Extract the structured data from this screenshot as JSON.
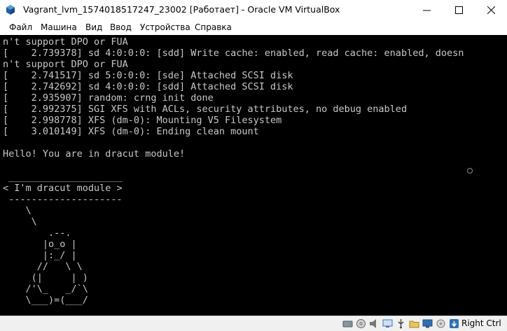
{
  "window": {
    "title": "Vagrant_lvm_1574018517247_23002 [Работает] - Oracle VM VirtualBox",
    "minimize_glyph": "—",
    "maximize_glyph": "☐",
    "close_glyph": "✕"
  },
  "menu": {
    "items": [
      {
        "label": "Файл"
      },
      {
        "label": "Машина"
      },
      {
        "label": "Вид"
      },
      {
        "label": "Ввод"
      },
      {
        "label": "Устройства"
      },
      {
        "label": "Справка"
      }
    ]
  },
  "console": {
    "lines": [
      "n't support DPO or FUA",
      "[    2.739378] sd 4:0:0:0: [sdd] Write cache: enabled, read cache: enabled, doesn",
      "n't support DPO or FUA",
      "[    2.741517] sd 5:0:0:0: [sde] Attached SCSI disk",
      "[    2.742692] sd 4:0:0:0: [sdd] Attached SCSI disk",
      "[    2.935907] random: crng init done",
      "[    2.992375] SGI XFS with ACLs, security attributes, no debug enabled",
      "[    2.998778] XFS (dm-0): Mounting V5 Filesystem",
      "[    3.010149] XFS (dm-0): Ending clean mount",
      "",
      "Hello! You are in dracut module!",
      "",
      " ____________________",
      "< I'm dracut module >",
      " --------------------",
      "    \\",
      "     \\",
      "        .--.",
      "       |o_o |",
      "       |:_/ |",
      "      //   \\ \\",
      "     (|     | )",
      "    /'\\_   _/`\\",
      "    \\___)=(___/",
      "_"
    ]
  },
  "status": {
    "host_key": "Right Ctrl",
    "icons": [
      {
        "name": "hard-disk-icon",
        "color": "#6c7a89"
      },
      {
        "name": "optical-drive-icon",
        "color": "#8a8a8a"
      },
      {
        "name": "audio-icon",
        "color": "#7a7a7a"
      },
      {
        "name": "network-icon",
        "color": "#3a73b8"
      },
      {
        "name": "usb-icon",
        "color": "#4a4a4a"
      },
      {
        "name": "shared-folders-icon",
        "color": "#c9a13a"
      },
      {
        "name": "display-icon",
        "color": "#2f6fb0"
      },
      {
        "name": "video-capture-icon",
        "color": "#7a7a7a"
      },
      {
        "name": "cpu-icon",
        "color": "#5a8a3a"
      },
      {
        "name": "mouse-integration-icon",
        "color": "#6a6a6a"
      },
      {
        "name": "host-key-arrow-icon",
        "color": "#2f6fb0"
      }
    ]
  }
}
